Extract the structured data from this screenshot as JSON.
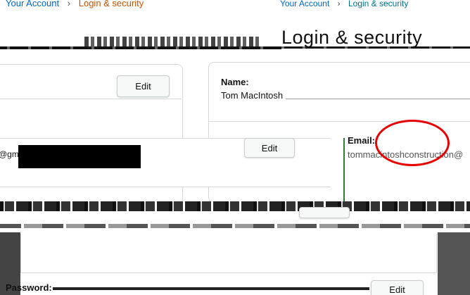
{
  "breadcrumb": {
    "left": [
      "Your Account",
      "Login & security"
    ],
    "separator": "›",
    "right": [
      "Your Account",
      "Login & security"
    ]
  },
  "page_title": "Login & security",
  "sections": {
    "top_left_edit": "Edit",
    "name": {
      "label": "Name:",
      "value": "Tom MacIntosh"
    },
    "middle_edit": "Edit",
    "email": {
      "label": "Email:",
      "value": "tommacintoshconstruction@",
      "left_fragment": "@gm"
    },
    "password": {
      "label": "Password:",
      "edit": "Edit"
    }
  },
  "colors": {
    "link": "#0066c0",
    "breadcrumb_current": "#c45500",
    "annotation": "#e60000",
    "button_bg": "#f7f8f8",
    "border": "#d5d9d9"
  }
}
